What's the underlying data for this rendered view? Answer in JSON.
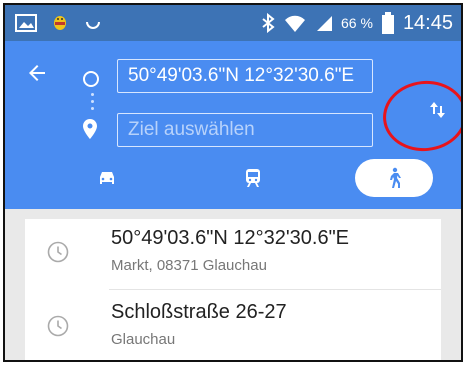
{
  "status_bar": {
    "battery_percent": "66 %",
    "time": "14:45"
  },
  "directions": {
    "origin_value": "50°49'03.6\"N 12°32'30.6\"E",
    "destination_placeholder": "Ziel auswählen",
    "selected_mode": "walking",
    "modes": [
      "driving",
      "transit",
      "walking"
    ]
  },
  "recent": [
    {
      "title": "50°49'03.6\"N 12°32'30.6\"E",
      "subtitle": "Markt, 08371 Glauchau",
      "icon": "clock-icon"
    },
    {
      "title": "Schloßstraße 26-27",
      "subtitle": "Glauchau",
      "icon": "clock-icon"
    }
  ],
  "colors": {
    "status_bar": "#3d73b5",
    "header": "#4a8cf1",
    "annotation": "#e8141b"
  }
}
